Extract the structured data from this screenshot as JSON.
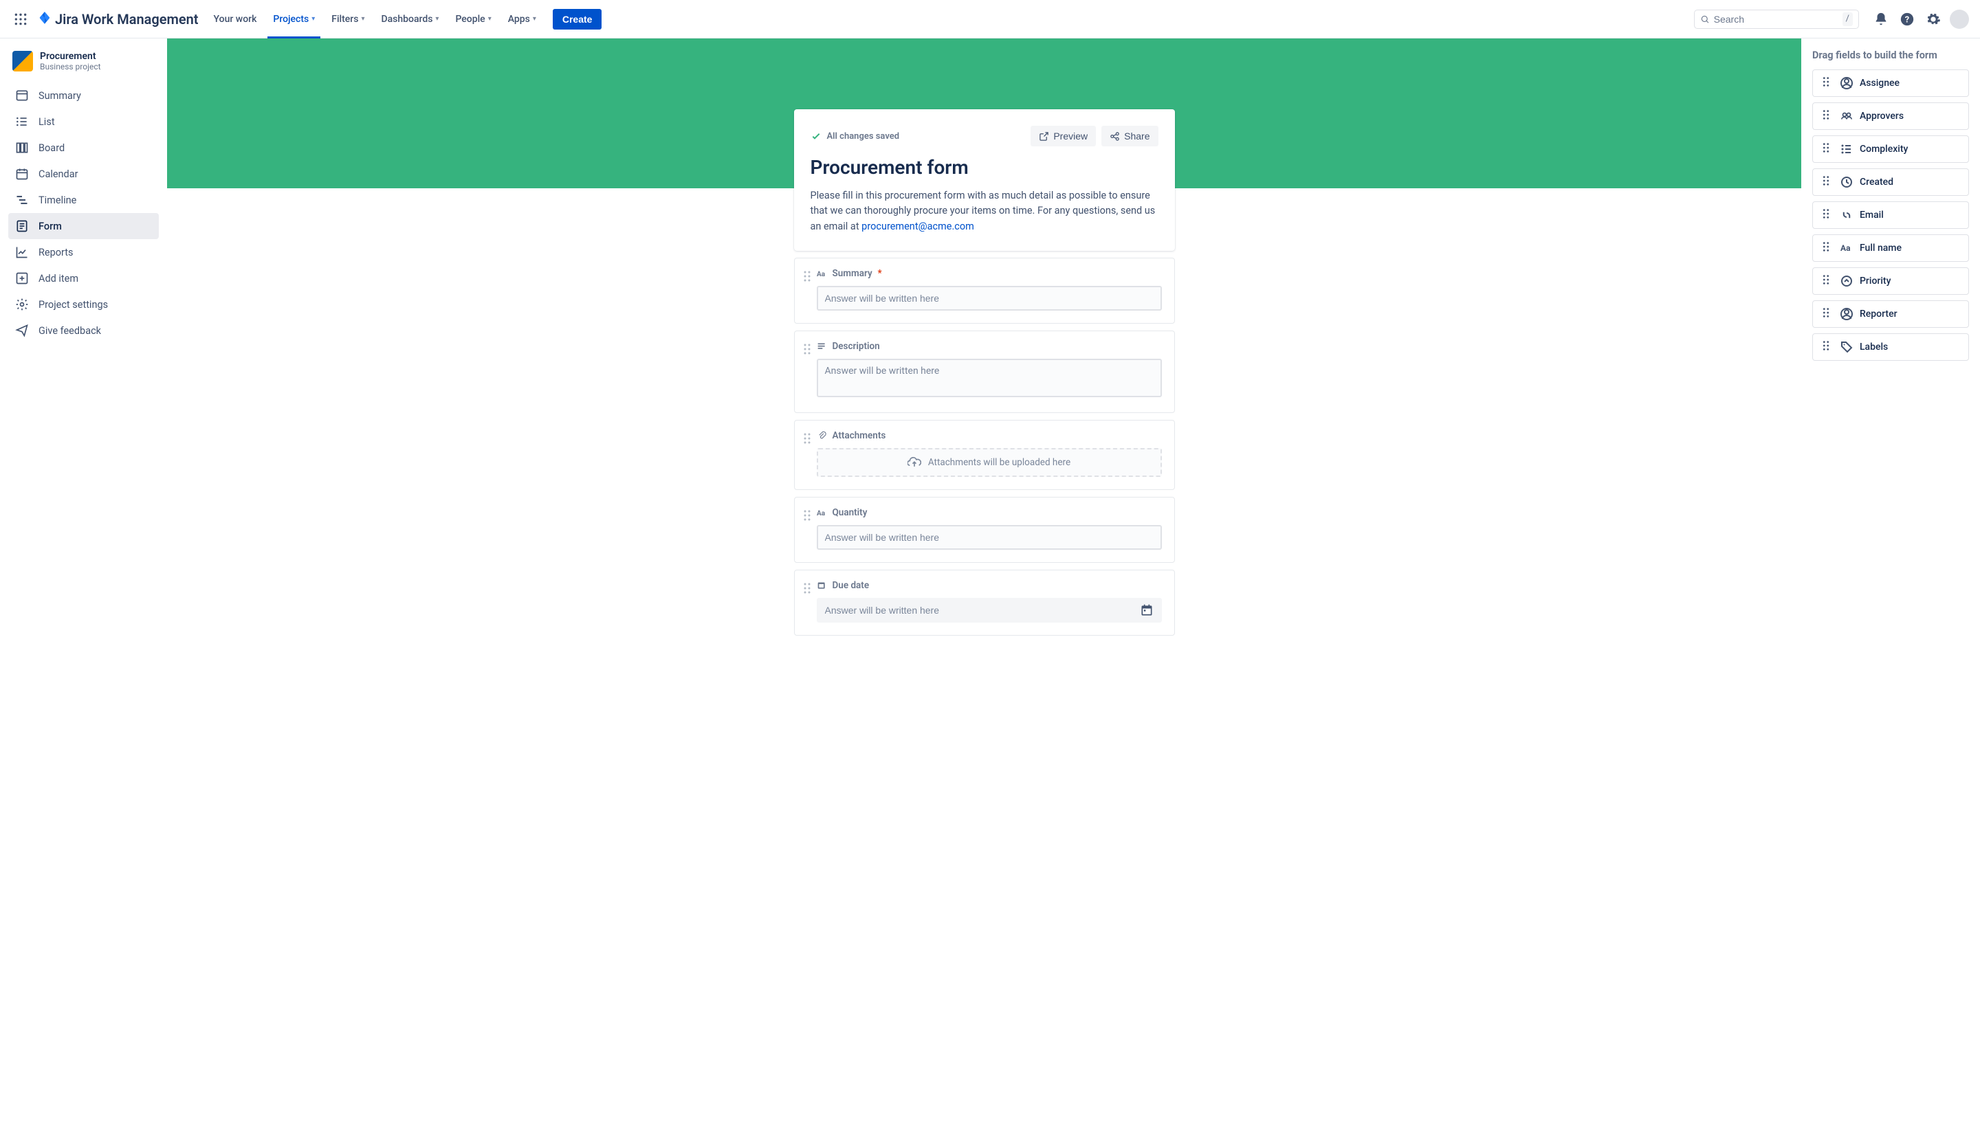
{
  "topnav": {
    "brand": "Jira Work Management",
    "links": [
      {
        "label": "Your work",
        "dropdown": false
      },
      {
        "label": "Projects",
        "dropdown": true,
        "active": true
      },
      {
        "label": "Filters",
        "dropdown": true
      },
      {
        "label": "Dashboards",
        "dropdown": true
      },
      {
        "label": "People",
        "dropdown": true
      },
      {
        "label": "Apps",
        "dropdown": true
      }
    ],
    "create": "Create",
    "search_placeholder": "Search",
    "search_kbd": "/"
  },
  "project": {
    "name": "Procurement",
    "subtitle": "Business project"
  },
  "sidebar": [
    {
      "label": "Summary",
      "icon": "summary"
    },
    {
      "label": "List",
      "icon": "list"
    },
    {
      "label": "Board",
      "icon": "board"
    },
    {
      "label": "Calendar",
      "icon": "calendar"
    },
    {
      "label": "Timeline",
      "icon": "timeline"
    },
    {
      "label": "Form",
      "icon": "form",
      "selected": true
    },
    {
      "label": "Reports",
      "icon": "reports"
    },
    {
      "label": "Add item",
      "icon": "add"
    },
    {
      "label": "Project settings",
      "icon": "settings"
    },
    {
      "label": "Give feedback",
      "icon": "feedback"
    }
  ],
  "form": {
    "saved_text": "All changes saved",
    "preview": "Preview",
    "share": "Share",
    "title": "Procurement form",
    "description": "Please fill in this procurement form with as much detail as possible to ensure that we can thoroughly procure your items on time. For any questions, send us an email at ",
    "email": "procurement@acme.com",
    "placeholder": "Answer will be written here",
    "attach_hint": "Attachments will be uploaded here",
    "fields": [
      {
        "label": "Summary",
        "type": "text",
        "required": true,
        "icon": "text"
      },
      {
        "label": "Description",
        "type": "textarea",
        "icon": "paragraph"
      },
      {
        "label": "Attachments",
        "type": "attachment",
        "icon": "attachment"
      },
      {
        "label": "Quantity",
        "type": "text",
        "icon": "text"
      },
      {
        "label": "Due date",
        "type": "date",
        "icon": "date"
      }
    ]
  },
  "right_panel": {
    "title": "Drag fields to build the form",
    "fields": [
      {
        "label": "Assignee",
        "icon": "user"
      },
      {
        "label": "Approvers",
        "icon": "group"
      },
      {
        "label": "Complexity",
        "icon": "list"
      },
      {
        "label": "Created",
        "icon": "clock"
      },
      {
        "label": "Email",
        "icon": "link"
      },
      {
        "label": "Full name",
        "icon": "text"
      },
      {
        "label": "Priority",
        "icon": "priority"
      },
      {
        "label": "Reporter",
        "icon": "user"
      },
      {
        "label": "Labels",
        "icon": "tag"
      }
    ]
  }
}
